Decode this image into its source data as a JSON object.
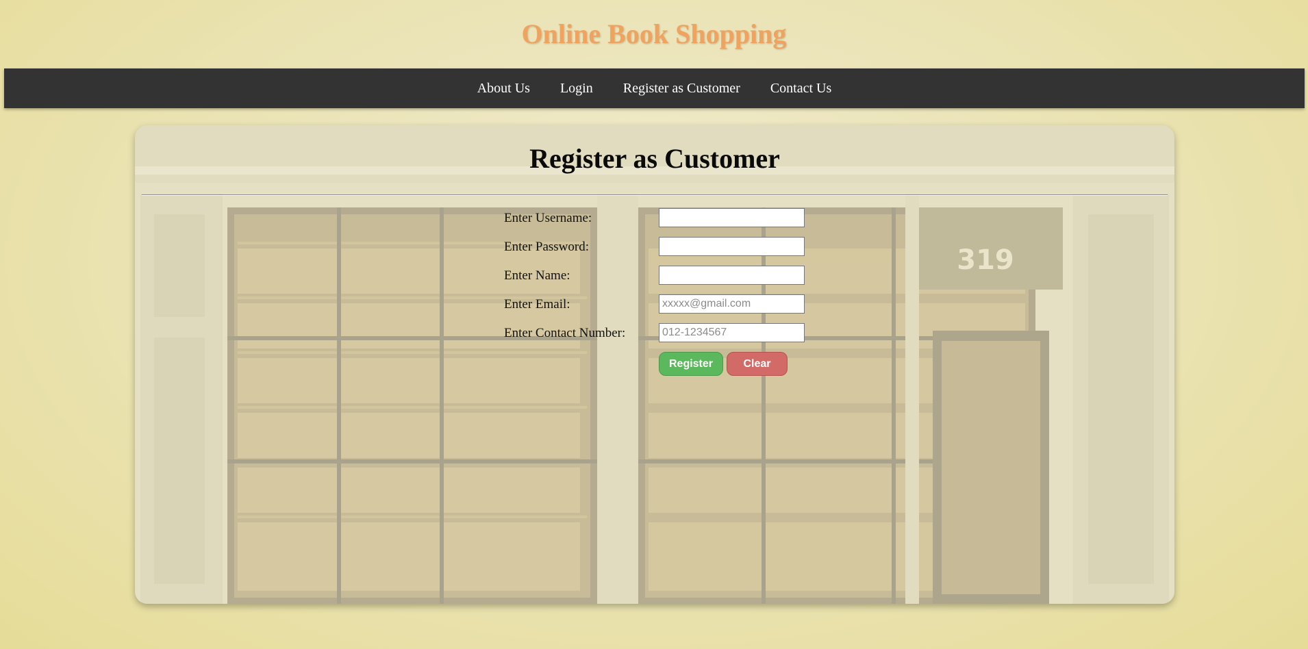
{
  "header": {
    "site_title": "Online Book Shopping"
  },
  "nav": {
    "items": [
      {
        "label": "About Us"
      },
      {
        "label": "Login"
      },
      {
        "label": "Register as Customer"
      },
      {
        "label": "Contact Us"
      }
    ]
  },
  "form": {
    "title": "Register as Customer",
    "fields": [
      {
        "label": "Enter Username:",
        "value": "",
        "placeholder": ""
      },
      {
        "label": "Enter Password:",
        "value": "",
        "placeholder": ""
      },
      {
        "label": "Enter Name:",
        "value": "",
        "placeholder": ""
      },
      {
        "label": "Enter Email:",
        "value": "",
        "placeholder": "xxxxx@gmail.com"
      },
      {
        "label": "Enter Contact Number:",
        "value": "",
        "placeholder": "012-1234567"
      }
    ],
    "register_label": "Register",
    "clear_label": "Clear"
  },
  "background": {
    "storefront_number": "319"
  },
  "colors": {
    "title": "#f0a35e",
    "navbar": "#333333",
    "register_button": "#5cb85c",
    "clear_button": "#d26a68"
  }
}
